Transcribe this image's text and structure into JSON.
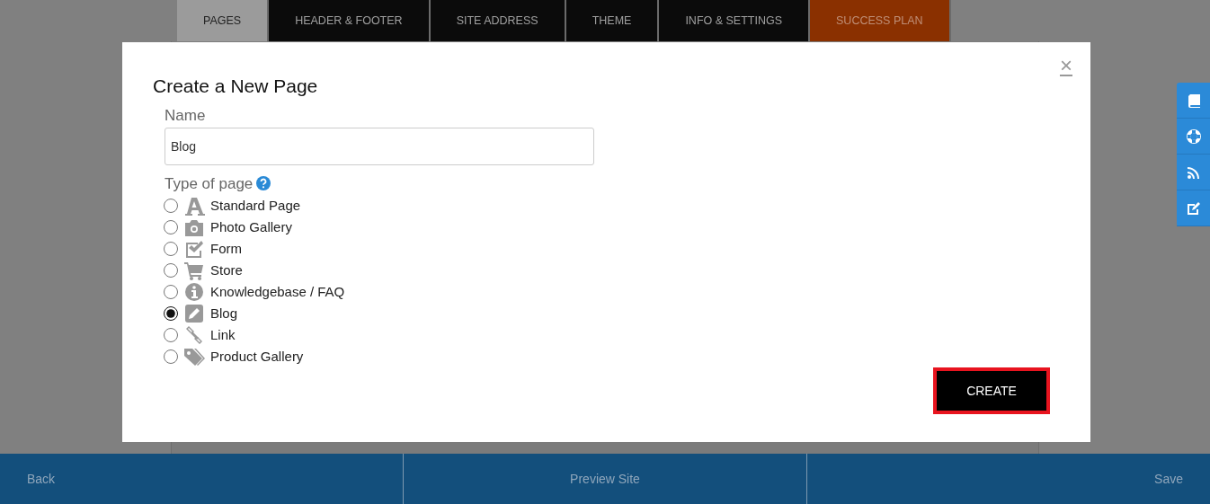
{
  "tabs": [
    {
      "label": "PAGES",
      "selected": true,
      "kind": "plain"
    },
    {
      "label": "HEADER & FOOTER",
      "selected": false,
      "kind": "plain"
    },
    {
      "label": "SITE ADDRESS",
      "selected": false,
      "kind": "plain"
    },
    {
      "label": "THEME",
      "selected": false,
      "kind": "plain"
    },
    {
      "label": "INFO & SETTINGS",
      "selected": false,
      "kind": "plain"
    },
    {
      "label": "SUCCESS PLAN",
      "selected": false,
      "kind": "highlight"
    }
  ],
  "modal": {
    "title": "Create a New Page",
    "close": "×",
    "name_label": "Name",
    "name_value": "Blog",
    "type_label": "Type of page",
    "page_types": [
      {
        "label": "Standard Page",
        "selected": false
      },
      {
        "label": "Photo Gallery",
        "selected": false
      },
      {
        "label": "Form",
        "selected": false
      },
      {
        "label": "Store",
        "selected": false
      },
      {
        "label": "Knowledgebase / FAQ",
        "selected": false
      },
      {
        "label": "Blog",
        "selected": true
      },
      {
        "label": "Link",
        "selected": false
      },
      {
        "label": "Product Gallery",
        "selected": false
      }
    ],
    "create_button": "CREATE"
  },
  "footer": [
    {
      "label": "Back"
    },
    {
      "label": "Preview Site"
    },
    {
      "label": "Save"
    }
  ]
}
